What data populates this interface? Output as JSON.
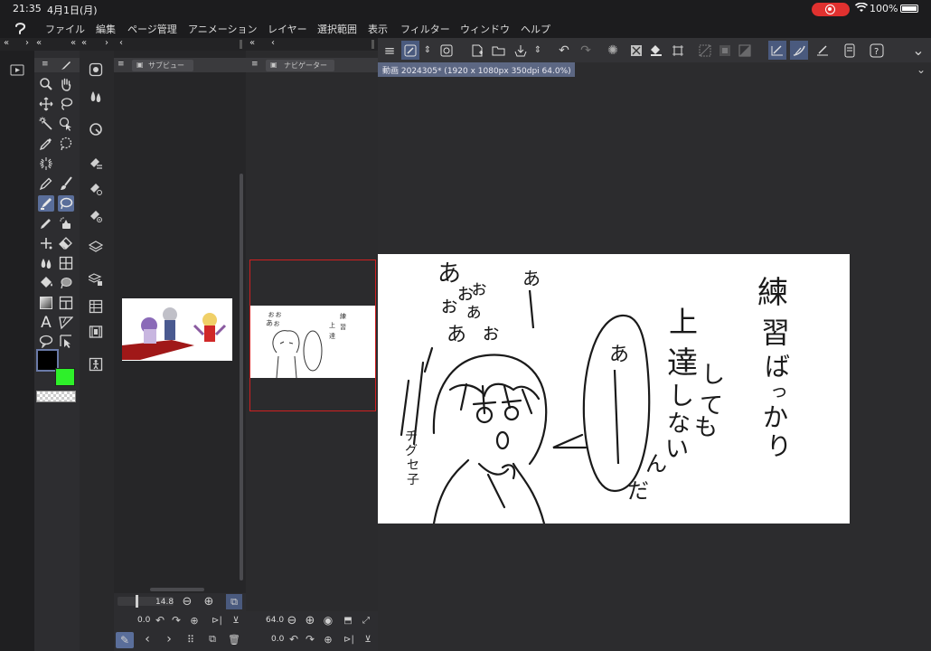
{
  "status_bar": {
    "time": "21:35",
    "date": "4月1日(月)",
    "battery": "100%"
  },
  "menu": {
    "items": [
      "ファイル",
      "編集",
      "ページ管理",
      "アニメーション",
      "レイヤー",
      "選択範囲",
      "表示",
      "フィルター",
      "ウィンドウ",
      "ヘルプ"
    ]
  },
  "panels": {
    "sub_view": {
      "title": "サブビュー"
    },
    "navigator": {
      "title": "ナビゲーター"
    }
  },
  "canvas_tab": {
    "title": "動画 2024305* (1920 x 1080px 350dpi 64.0%)"
  },
  "sub_view_controls": {
    "zoom": "14.8",
    "rotation": "0.0"
  },
  "navigator_controls": {
    "zoom": "64.0",
    "rotation": "0.0"
  },
  "colors": {
    "main_color": "#000000",
    "sub_color": "#2ef02a",
    "selection_accent": "#5a6e9a",
    "canvas_tab": "#5c6783",
    "record_indicator": "#e0312f"
  },
  "drawing_text": {
    "col1": "練習ばっかりしてても",
    "col2": "上達しないんだ",
    "bubble": "あー",
    "screams": "ああああ",
    "signature": "チグセ子"
  }
}
